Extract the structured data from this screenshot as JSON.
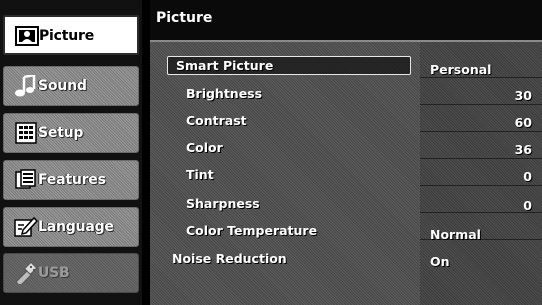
{
  "sidebar": {
    "items": [
      {
        "label": "Picture",
        "icon": "picture-icon",
        "state": "active"
      },
      {
        "label": "Sound",
        "icon": "sound-icon",
        "state": "normal"
      },
      {
        "label": "Setup",
        "icon": "setup-icon",
        "state": "normal"
      },
      {
        "label": "Features",
        "icon": "features-icon",
        "state": "normal"
      },
      {
        "label": "Language",
        "icon": "language-icon",
        "state": "normal"
      },
      {
        "label": "USB",
        "icon": "usb-icon",
        "state": "disabled"
      }
    ]
  },
  "header": {
    "title": "Picture"
  },
  "menu": {
    "rows": [
      {
        "label": "Smart Picture",
        "value": "Personal",
        "selected": true
      },
      {
        "label": "Brightness",
        "value": "30"
      },
      {
        "label": "Contrast",
        "value": "60"
      },
      {
        "label": "Color",
        "value": "36"
      },
      {
        "label": "Tint",
        "value": "0"
      },
      {
        "label": "Sharpness",
        "value": "0"
      },
      {
        "label": "Color Temperature",
        "value": "Normal"
      },
      {
        "label": "Noise Reduction",
        "value": "On"
      }
    ]
  }
}
